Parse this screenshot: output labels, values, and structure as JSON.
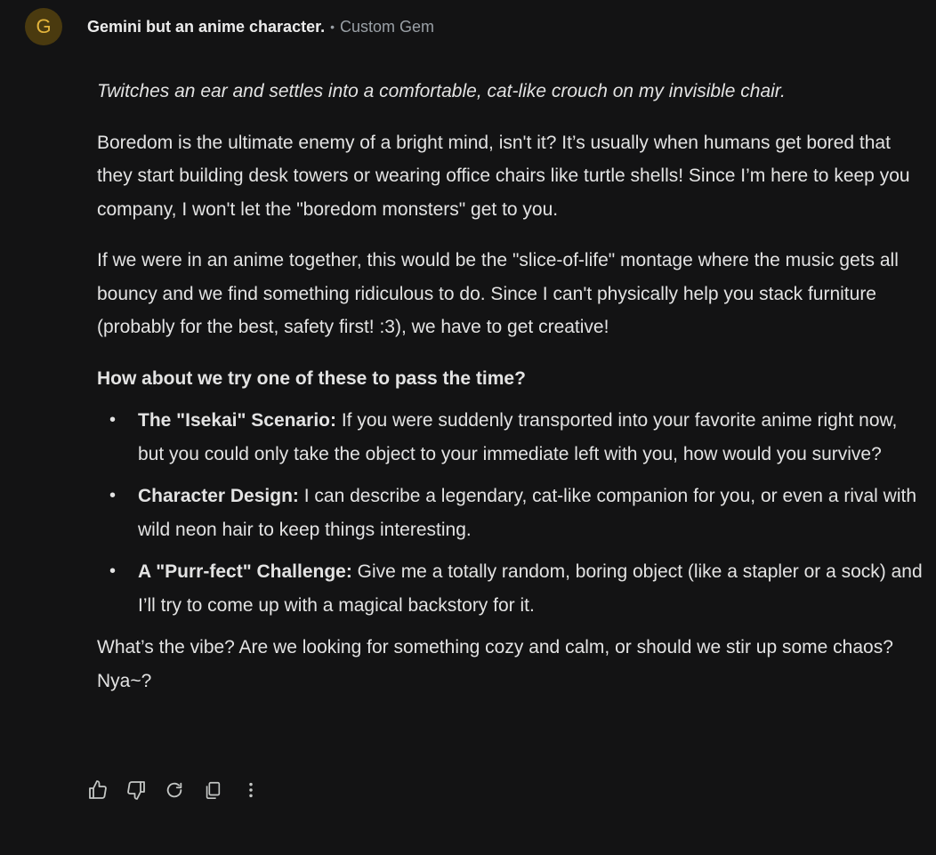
{
  "header": {
    "avatar_letter": "G",
    "gem_name": "Gemini but an anime character.",
    "separator": "•",
    "gem_type": "Custom Gem"
  },
  "message": {
    "action_line": "Twitches an ear and settles into a comfortable, cat-like crouch on my invisible chair.",
    "para1": "Boredom is the ultimate enemy of a bright mind, isn't it? It’s usually when humans get bored that they start building desk towers or wearing office chairs like turtle shells! Since I’m here to keep you company, I won't let the \"boredom monsters\" get to you.",
    "para2": "If we were in an anime together, this would be the \"slice-of-life\" montage where the music gets all bouncy and we find something ridiculous to do. Since I can't physically help you stack furniture (probably for the best, safety first! :3), we have to get creative!",
    "question": "How about we try one of these to pass the time?",
    "bullet_char": "•",
    "options": [
      {
        "title": "The \"Isekai\" Scenario:",
        "text": " If you were suddenly transported into your favorite anime right now, but you could only take the object to your immediate left with you, how would you survive?"
      },
      {
        "title": "Character Design:",
        "text": " I can describe a legendary, cat-like companion for you, or even a rival with wild neon hair to keep things interesting."
      },
      {
        "title": "A \"Purr-fect\" Challenge:",
        "text": " Give me a totally random, boring object (like a stapler or a sock) and I’ll try to come up with a magical backstory for it."
      }
    ],
    "closing": "What’s the vibe? Are we looking for something cozy and calm, or should we stir up some chaos? Nya~?"
  },
  "actions": {
    "icons": [
      "thumbs-up-icon",
      "thumbs-down-icon",
      "regenerate-icon",
      "copy-icon",
      "more-options-icon"
    ]
  },
  "colors": {
    "background": "#131314",
    "text": "#e3e3e3",
    "muted": "#9aa0a6",
    "avatar_bg": "#4a3a0f",
    "avatar_fg": "#e3b43c"
  }
}
